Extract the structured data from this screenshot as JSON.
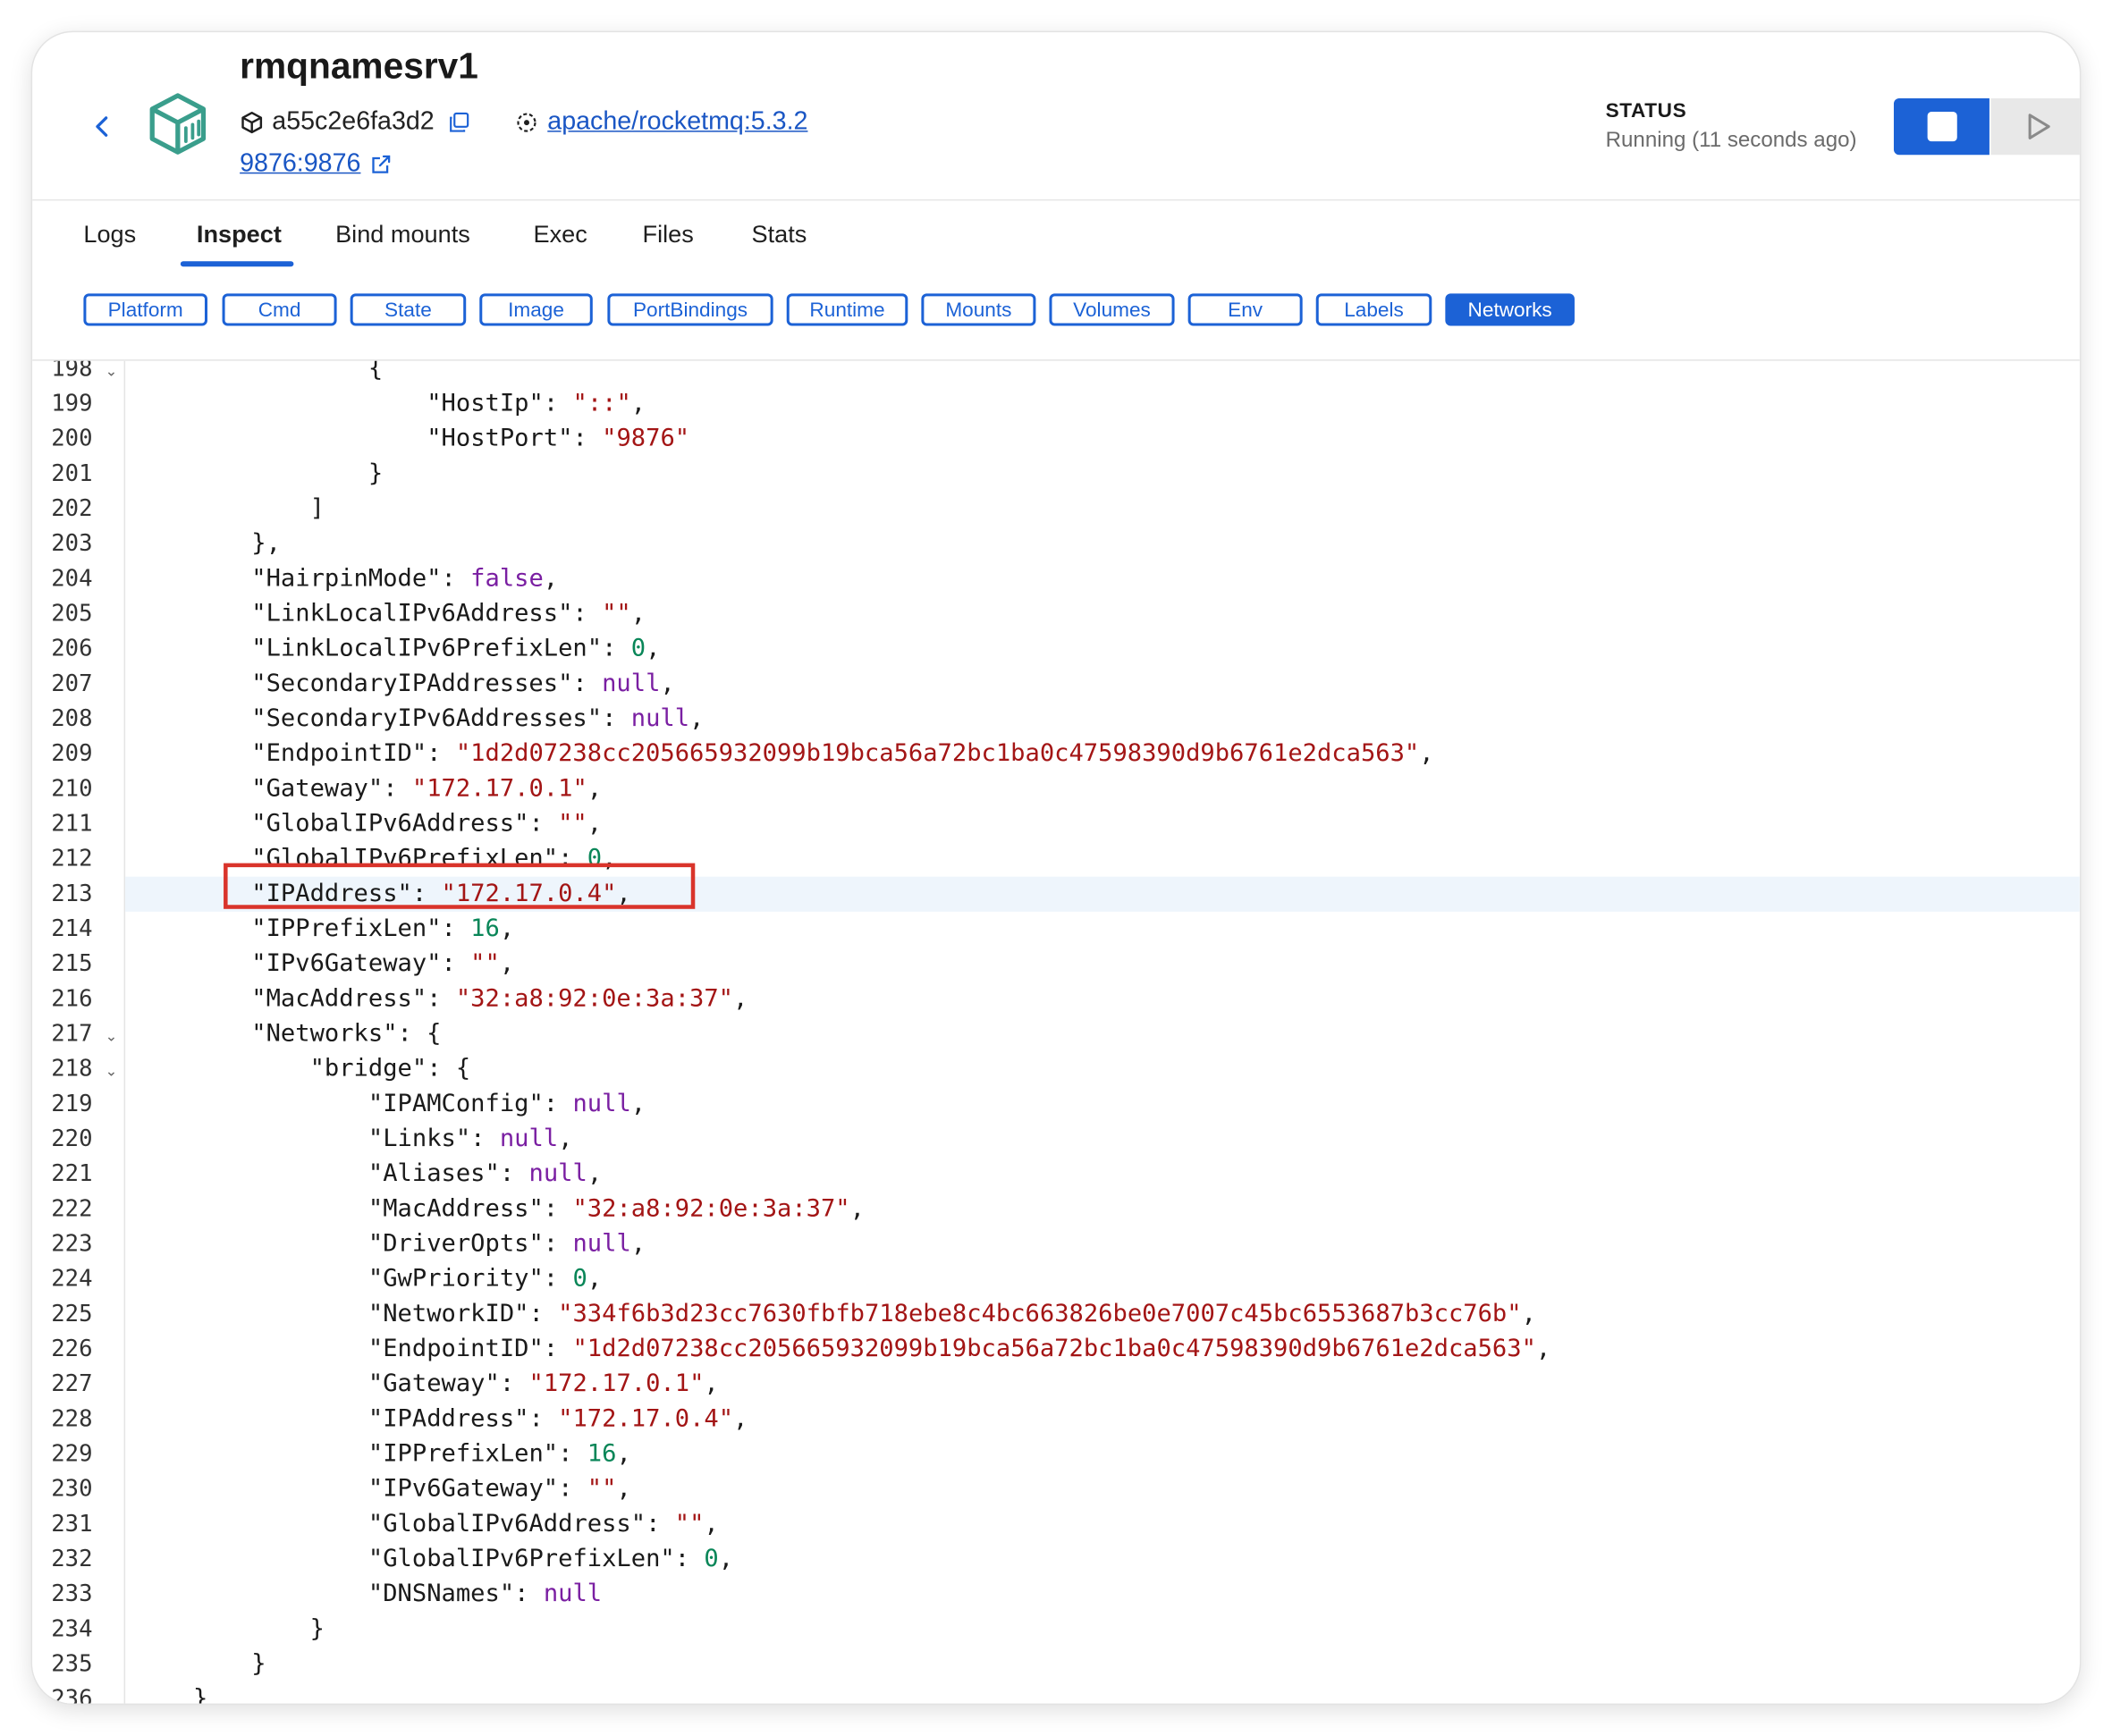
{
  "header": {
    "title": "rmqnamesrv1",
    "container_id": "a55c2e6fa3d2",
    "image_link": "apache/rocketmq:5.3.2",
    "port_link": "9876:9876",
    "status_label": "STATUS",
    "status_value": "Running (11 seconds ago)"
  },
  "icons": [
    "chevron-left-icon",
    "container-cube-icon",
    "cube-icon",
    "copy-icon",
    "image-icon",
    "external-link-icon",
    "stop-icon",
    "play-icon",
    "fold-chevron-icon"
  ],
  "colors": {
    "accent": "#1c62d6",
    "string": "#a31515",
    "number": "#098658",
    "keyword": "#7a1fa2",
    "container_icon": "#3a9e8c",
    "highlight_box": "#d9342b"
  },
  "tabs": [
    {
      "label": "Logs",
      "active": false
    },
    {
      "label": "Inspect",
      "active": true
    },
    {
      "label": "Bind mounts",
      "active": false
    },
    {
      "label": "Exec",
      "active": false
    },
    {
      "label": "Files",
      "active": false
    },
    {
      "label": "Stats",
      "active": false
    }
  ],
  "chips": [
    {
      "label": "Platform",
      "active": false
    },
    {
      "label": "Cmd",
      "active": false
    },
    {
      "label": "State",
      "active": false
    },
    {
      "label": "Image",
      "active": false
    },
    {
      "label": "PortBindings",
      "active": false
    },
    {
      "label": "Runtime",
      "active": false
    },
    {
      "label": "Mounts",
      "active": false
    },
    {
      "label": "Volumes",
      "active": false
    },
    {
      "label": "Env",
      "active": false
    },
    {
      "label": "Labels",
      "active": false
    },
    {
      "label": "Networks",
      "active": true
    }
  ],
  "editor": {
    "current_line": 213,
    "boxed_line": 213,
    "lines": [
      {
        "n": "198",
        "fold": true,
        "indent": 16,
        "t": [
          [
            "p",
            "{"
          ]
        ]
      },
      {
        "n": "199",
        "indent": 20,
        "t": [
          [
            "k",
            "\"HostIp\""
          ],
          [
            "p",
            ": "
          ],
          [
            "s",
            "\"::\""
          ],
          [
            "p",
            ","
          ]
        ]
      },
      {
        "n": "200",
        "indent": 20,
        "t": [
          [
            "k",
            "\"HostPort\""
          ],
          [
            "p",
            ": "
          ],
          [
            "s",
            "\"9876\""
          ]
        ]
      },
      {
        "n": "201",
        "indent": 16,
        "t": [
          [
            "p",
            "}"
          ]
        ]
      },
      {
        "n": "202",
        "indent": 12,
        "t": [
          [
            "p",
            "]"
          ]
        ]
      },
      {
        "n": "203",
        "indent": 8,
        "t": [
          [
            "p",
            "},"
          ]
        ]
      },
      {
        "n": "204",
        "indent": 8,
        "t": [
          [
            "k",
            "\"HairpinMode\""
          ],
          [
            "p",
            ": "
          ],
          [
            "b",
            "false"
          ],
          [
            "p",
            ","
          ]
        ]
      },
      {
        "n": "205",
        "indent": 8,
        "t": [
          [
            "k",
            "\"LinkLocalIPv6Address\""
          ],
          [
            "p",
            ": "
          ],
          [
            "s",
            "\"\""
          ],
          [
            "p",
            ","
          ]
        ]
      },
      {
        "n": "206",
        "indent": 8,
        "t": [
          [
            "k",
            "\"LinkLocalIPv6PrefixLen\""
          ],
          [
            "p",
            ": "
          ],
          [
            "n",
            "0"
          ],
          [
            "p",
            ","
          ]
        ]
      },
      {
        "n": "207",
        "indent": 8,
        "t": [
          [
            "k",
            "\"SecondaryIPAddresses\""
          ],
          [
            "p",
            ": "
          ],
          [
            "b",
            "null"
          ],
          [
            "p",
            ","
          ]
        ]
      },
      {
        "n": "208",
        "indent": 8,
        "t": [
          [
            "k",
            "\"SecondaryIPv6Addresses\""
          ],
          [
            "p",
            ": "
          ],
          [
            "b",
            "null"
          ],
          [
            "p",
            ","
          ]
        ]
      },
      {
        "n": "209",
        "indent": 8,
        "t": [
          [
            "k",
            "\"EndpointID\""
          ],
          [
            "p",
            ": "
          ],
          [
            "s",
            "\"1d2d07238cc205665932099b19bca56a72bc1ba0c47598390d9b6761e2dca563\""
          ],
          [
            "p",
            ","
          ]
        ]
      },
      {
        "n": "210",
        "indent": 8,
        "t": [
          [
            "k",
            "\"Gateway\""
          ],
          [
            "p",
            ": "
          ],
          [
            "s",
            "\"172.17.0.1\""
          ],
          [
            "p",
            ","
          ]
        ]
      },
      {
        "n": "211",
        "indent": 8,
        "t": [
          [
            "k",
            "\"GlobalIPv6Address\""
          ],
          [
            "p",
            ": "
          ],
          [
            "s",
            "\"\""
          ],
          [
            "p",
            ","
          ]
        ]
      },
      {
        "n": "212",
        "indent": 8,
        "t": [
          [
            "k",
            "\"GlobalIPv6PrefixLen\""
          ],
          [
            "p",
            ": "
          ],
          [
            "n",
            "0"
          ],
          [
            "p",
            ","
          ]
        ]
      },
      {
        "n": "213",
        "indent": 8,
        "t": [
          [
            "k",
            "\"IPAddress\""
          ],
          [
            "p",
            ": "
          ],
          [
            "s",
            "\"172.17.0.4\""
          ],
          [
            "p",
            ","
          ]
        ]
      },
      {
        "n": "214",
        "indent": 8,
        "t": [
          [
            "k",
            "\"IPPrefixLen\""
          ],
          [
            "p",
            ": "
          ],
          [
            "n",
            "16"
          ],
          [
            "p",
            ","
          ]
        ]
      },
      {
        "n": "215",
        "indent": 8,
        "t": [
          [
            "k",
            "\"IPv6Gateway\""
          ],
          [
            "p",
            ": "
          ],
          [
            "s",
            "\"\""
          ],
          [
            "p",
            ","
          ]
        ]
      },
      {
        "n": "216",
        "indent": 8,
        "t": [
          [
            "k",
            "\"MacAddress\""
          ],
          [
            "p",
            ": "
          ],
          [
            "s",
            "\"32:a8:92:0e:3a:37\""
          ],
          [
            "p",
            ","
          ]
        ]
      },
      {
        "n": "217",
        "fold": true,
        "indent": 8,
        "t": [
          [
            "k",
            "\"Networks\""
          ],
          [
            "p",
            ": {"
          ]
        ]
      },
      {
        "n": "218",
        "fold": true,
        "indent": 12,
        "t": [
          [
            "k",
            "\"bridge\""
          ],
          [
            "p",
            ": {"
          ]
        ]
      },
      {
        "n": "219",
        "indent": 16,
        "t": [
          [
            "k",
            "\"IPAMConfig\""
          ],
          [
            "p",
            ": "
          ],
          [
            "b",
            "null"
          ],
          [
            "p",
            ","
          ]
        ]
      },
      {
        "n": "220",
        "indent": 16,
        "t": [
          [
            "k",
            "\"Links\""
          ],
          [
            "p",
            ": "
          ],
          [
            "b",
            "null"
          ],
          [
            "p",
            ","
          ]
        ]
      },
      {
        "n": "221",
        "indent": 16,
        "t": [
          [
            "k",
            "\"Aliases\""
          ],
          [
            "p",
            ": "
          ],
          [
            "b",
            "null"
          ],
          [
            "p",
            ","
          ]
        ]
      },
      {
        "n": "222",
        "indent": 16,
        "t": [
          [
            "k",
            "\"MacAddress\""
          ],
          [
            "p",
            ": "
          ],
          [
            "s",
            "\"32:a8:92:0e:3a:37\""
          ],
          [
            "p",
            ","
          ]
        ]
      },
      {
        "n": "223",
        "indent": 16,
        "t": [
          [
            "k",
            "\"DriverOpts\""
          ],
          [
            "p",
            ": "
          ],
          [
            "b",
            "null"
          ],
          [
            "p",
            ","
          ]
        ]
      },
      {
        "n": "224",
        "indent": 16,
        "t": [
          [
            "k",
            "\"GwPriority\""
          ],
          [
            "p",
            ": "
          ],
          [
            "n",
            "0"
          ],
          [
            "p",
            ","
          ]
        ]
      },
      {
        "n": "225",
        "indent": 16,
        "t": [
          [
            "k",
            "\"NetworkID\""
          ],
          [
            "p",
            ": "
          ],
          [
            "s",
            "\"334f6b3d23cc7630fbfb718ebe8c4bc663826be0e7007c45bc6553687b3cc76b\""
          ],
          [
            "p",
            ","
          ]
        ]
      },
      {
        "n": "226",
        "indent": 16,
        "t": [
          [
            "k",
            "\"EndpointID\""
          ],
          [
            "p",
            ": "
          ],
          [
            "s",
            "\"1d2d07238cc205665932099b19bca56a72bc1ba0c47598390d9b6761e2dca563\""
          ],
          [
            "p",
            ","
          ]
        ]
      },
      {
        "n": "227",
        "indent": 16,
        "t": [
          [
            "k",
            "\"Gateway\""
          ],
          [
            "p",
            ": "
          ],
          [
            "s",
            "\"172.17.0.1\""
          ],
          [
            "p",
            ","
          ]
        ]
      },
      {
        "n": "228",
        "indent": 16,
        "t": [
          [
            "k",
            "\"IPAddress\""
          ],
          [
            "p",
            ": "
          ],
          [
            "s",
            "\"172.17.0.4\""
          ],
          [
            "p",
            ","
          ]
        ]
      },
      {
        "n": "229",
        "indent": 16,
        "t": [
          [
            "k",
            "\"IPPrefixLen\""
          ],
          [
            "p",
            ": "
          ],
          [
            "n",
            "16"
          ],
          [
            "p",
            ","
          ]
        ]
      },
      {
        "n": "230",
        "indent": 16,
        "t": [
          [
            "k",
            "\"IPv6Gateway\""
          ],
          [
            "p",
            ": "
          ],
          [
            "s",
            "\"\""
          ],
          [
            "p",
            ","
          ]
        ]
      },
      {
        "n": "231",
        "indent": 16,
        "t": [
          [
            "k",
            "\"GlobalIPv6Address\""
          ],
          [
            "p",
            ": "
          ],
          [
            "s",
            "\"\""
          ],
          [
            "p",
            ","
          ]
        ]
      },
      {
        "n": "232",
        "indent": 16,
        "t": [
          [
            "k",
            "\"GlobalIPv6PrefixLen\""
          ],
          [
            "p",
            ": "
          ],
          [
            "n",
            "0"
          ],
          [
            "p",
            ","
          ]
        ]
      },
      {
        "n": "233",
        "indent": 16,
        "t": [
          [
            "k",
            "\"DNSNames\""
          ],
          [
            "p",
            ": "
          ],
          [
            "b",
            "null"
          ]
        ]
      },
      {
        "n": "234",
        "indent": 12,
        "t": [
          [
            "p",
            "}"
          ]
        ]
      },
      {
        "n": "235",
        "indent": 8,
        "t": [
          [
            "p",
            "}"
          ]
        ]
      },
      {
        "n": "236",
        "indent": 4,
        "t": [
          [
            "p",
            "}"
          ]
        ]
      }
    ]
  }
}
